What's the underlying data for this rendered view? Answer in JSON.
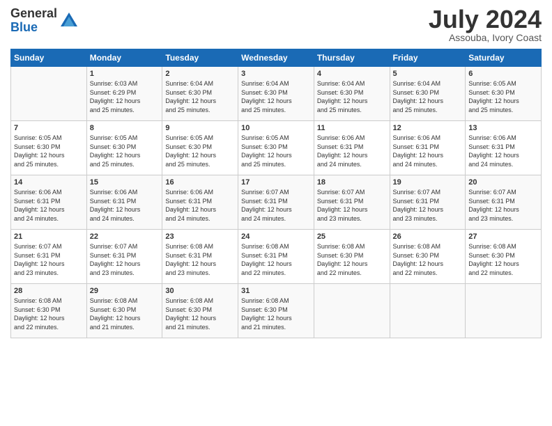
{
  "logo": {
    "general": "General",
    "blue": "Blue"
  },
  "title": "July 2024",
  "location": "Assouba, Ivory Coast",
  "days_header": [
    "Sunday",
    "Monday",
    "Tuesday",
    "Wednesday",
    "Thursday",
    "Friday",
    "Saturday"
  ],
  "weeks": [
    [
      {
        "day": "",
        "info": ""
      },
      {
        "day": "1",
        "info": "Sunrise: 6:03 AM\nSunset: 6:29 PM\nDaylight: 12 hours\nand 25 minutes."
      },
      {
        "day": "2",
        "info": "Sunrise: 6:04 AM\nSunset: 6:30 PM\nDaylight: 12 hours\nand 25 minutes."
      },
      {
        "day": "3",
        "info": "Sunrise: 6:04 AM\nSunset: 6:30 PM\nDaylight: 12 hours\nand 25 minutes."
      },
      {
        "day": "4",
        "info": "Sunrise: 6:04 AM\nSunset: 6:30 PM\nDaylight: 12 hours\nand 25 minutes."
      },
      {
        "day": "5",
        "info": "Sunrise: 6:04 AM\nSunset: 6:30 PM\nDaylight: 12 hours\nand 25 minutes."
      },
      {
        "day": "6",
        "info": "Sunrise: 6:05 AM\nSunset: 6:30 PM\nDaylight: 12 hours\nand 25 minutes."
      }
    ],
    [
      {
        "day": "7",
        "info": "Sunrise: 6:05 AM\nSunset: 6:30 PM\nDaylight: 12 hours\nand 25 minutes."
      },
      {
        "day": "8",
        "info": "Sunrise: 6:05 AM\nSunset: 6:30 PM\nDaylight: 12 hours\nand 25 minutes."
      },
      {
        "day": "9",
        "info": "Sunrise: 6:05 AM\nSunset: 6:30 PM\nDaylight: 12 hours\nand 25 minutes."
      },
      {
        "day": "10",
        "info": "Sunrise: 6:05 AM\nSunset: 6:30 PM\nDaylight: 12 hours\nand 25 minutes."
      },
      {
        "day": "11",
        "info": "Sunrise: 6:06 AM\nSunset: 6:31 PM\nDaylight: 12 hours\nand 24 minutes."
      },
      {
        "day": "12",
        "info": "Sunrise: 6:06 AM\nSunset: 6:31 PM\nDaylight: 12 hours\nand 24 minutes."
      },
      {
        "day": "13",
        "info": "Sunrise: 6:06 AM\nSunset: 6:31 PM\nDaylight: 12 hours\nand 24 minutes."
      }
    ],
    [
      {
        "day": "14",
        "info": "Sunrise: 6:06 AM\nSunset: 6:31 PM\nDaylight: 12 hours\nand 24 minutes."
      },
      {
        "day": "15",
        "info": "Sunrise: 6:06 AM\nSunset: 6:31 PM\nDaylight: 12 hours\nand 24 minutes."
      },
      {
        "day": "16",
        "info": "Sunrise: 6:06 AM\nSunset: 6:31 PM\nDaylight: 12 hours\nand 24 minutes."
      },
      {
        "day": "17",
        "info": "Sunrise: 6:07 AM\nSunset: 6:31 PM\nDaylight: 12 hours\nand 24 minutes."
      },
      {
        "day": "18",
        "info": "Sunrise: 6:07 AM\nSunset: 6:31 PM\nDaylight: 12 hours\nand 23 minutes."
      },
      {
        "day": "19",
        "info": "Sunrise: 6:07 AM\nSunset: 6:31 PM\nDaylight: 12 hours\nand 23 minutes."
      },
      {
        "day": "20",
        "info": "Sunrise: 6:07 AM\nSunset: 6:31 PM\nDaylight: 12 hours\nand 23 minutes."
      }
    ],
    [
      {
        "day": "21",
        "info": "Sunrise: 6:07 AM\nSunset: 6:31 PM\nDaylight: 12 hours\nand 23 minutes."
      },
      {
        "day": "22",
        "info": "Sunrise: 6:07 AM\nSunset: 6:31 PM\nDaylight: 12 hours\nand 23 minutes."
      },
      {
        "day": "23",
        "info": "Sunrise: 6:08 AM\nSunset: 6:31 PM\nDaylight: 12 hours\nand 23 minutes."
      },
      {
        "day": "24",
        "info": "Sunrise: 6:08 AM\nSunset: 6:31 PM\nDaylight: 12 hours\nand 22 minutes."
      },
      {
        "day": "25",
        "info": "Sunrise: 6:08 AM\nSunset: 6:30 PM\nDaylight: 12 hours\nand 22 minutes."
      },
      {
        "day": "26",
        "info": "Sunrise: 6:08 AM\nSunset: 6:30 PM\nDaylight: 12 hours\nand 22 minutes."
      },
      {
        "day": "27",
        "info": "Sunrise: 6:08 AM\nSunset: 6:30 PM\nDaylight: 12 hours\nand 22 minutes."
      }
    ],
    [
      {
        "day": "28",
        "info": "Sunrise: 6:08 AM\nSunset: 6:30 PM\nDaylight: 12 hours\nand 22 minutes."
      },
      {
        "day": "29",
        "info": "Sunrise: 6:08 AM\nSunset: 6:30 PM\nDaylight: 12 hours\nand 21 minutes."
      },
      {
        "day": "30",
        "info": "Sunrise: 6:08 AM\nSunset: 6:30 PM\nDaylight: 12 hours\nand 21 minutes."
      },
      {
        "day": "31",
        "info": "Sunrise: 6:08 AM\nSunset: 6:30 PM\nDaylight: 12 hours\nand 21 minutes."
      },
      {
        "day": "",
        "info": ""
      },
      {
        "day": "",
        "info": ""
      },
      {
        "day": "",
        "info": ""
      }
    ]
  ]
}
